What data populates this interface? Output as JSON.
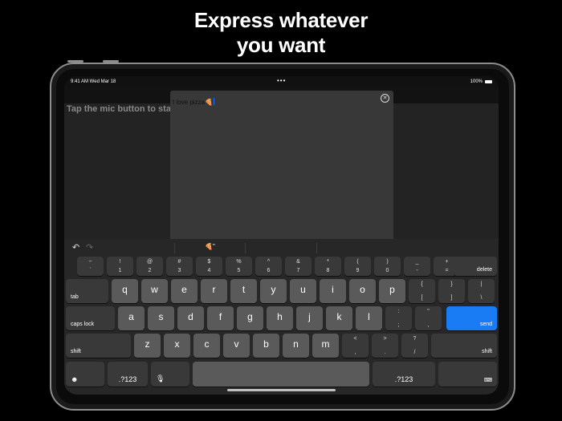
{
  "headline": {
    "line1": "Express whatever",
    "line2": "you want"
  },
  "status_bar": {
    "time": "9:41 AM  Wed Mar 18",
    "dots": "•••",
    "right": "100%"
  },
  "main": {
    "prompt": "Tap the mic button to sta"
  },
  "overlay": {
    "text": "I love pizza",
    "emoji": "🍕",
    "close": "✕"
  },
  "prediction": {
    "undo": "↶",
    "redo": "↷",
    "middle": "🍕\""
  },
  "keyboard": {
    "row1": [
      {
        "top": "~",
        "bottom": "`"
      },
      {
        "top": "!",
        "bottom": "1"
      },
      {
        "top": "@",
        "bottom": "2"
      },
      {
        "top": "#",
        "bottom": "3"
      },
      {
        "top": "$",
        "bottom": "4"
      },
      {
        "top": "%",
        "bottom": "5"
      },
      {
        "top": "^",
        "bottom": "6"
      },
      {
        "top": "&",
        "bottom": "7"
      },
      {
        "top": "*",
        "bottom": "8"
      },
      {
        "top": "(",
        "bottom": "9"
      },
      {
        "top": ")",
        "bottom": "0"
      },
      {
        "top": "_",
        "bottom": "-"
      },
      {
        "top": "+",
        "bottom": "="
      }
    ],
    "delete": "delete",
    "tab": "tab",
    "row2": [
      "q",
      "w",
      "e",
      "r",
      "t",
      "y",
      "u",
      "i",
      "o",
      "p"
    ],
    "row2_sym": [
      {
        "top": "{",
        "bottom": "["
      },
      {
        "top": "}",
        "bottom": "]"
      },
      {
        "top": "|",
        "bottom": "\\"
      }
    ],
    "caps": "caps lock",
    "row3": [
      "a",
      "s",
      "d",
      "f",
      "g",
      "h",
      "j",
      "k",
      "l"
    ],
    "row3_sym": [
      {
        "top": ":",
        "bottom": ";"
      },
      {
        "top": "\"",
        "bottom": ","
      }
    ],
    "send": "send",
    "shift": "shift",
    "row4": [
      "z",
      "x",
      "c",
      "v",
      "b",
      "n",
      "m"
    ],
    "row4_sym": [
      {
        "top": "<",
        "bottom": ","
      },
      {
        "top": ">",
        "bottom": "."
      },
      {
        "top": "?",
        "bottom": "/"
      }
    ],
    "emoji_icon": "☻",
    "mode_left": ".?123",
    "mic_icon": "🎙",
    "mode_right": ".?123",
    "hide_icon": "⌨"
  }
}
